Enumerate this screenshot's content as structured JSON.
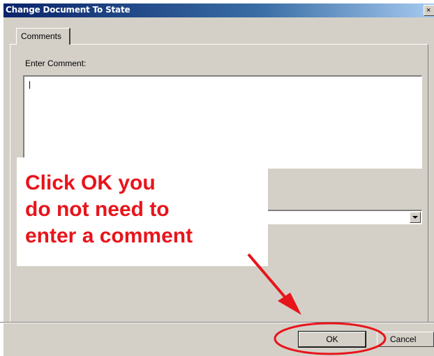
{
  "window": {
    "title": "Change Document To State",
    "close_glyph": "×"
  },
  "tabs": [
    {
      "label": "Comments",
      "active": true
    }
  ],
  "comment": {
    "label": "Enter Comment:",
    "value": "|"
  },
  "state_select": {
    "value": ""
  },
  "buttons": {
    "ok_label": "OK",
    "cancel_label": "Cancel"
  },
  "annotation": {
    "lines": [
      "Click OK you",
      "do not need to",
      "enter a comment"
    ],
    "color": "#e8141b"
  },
  "colors": {
    "dialog_bg": "#d4d0c8",
    "titlebar_start": "#0a246a",
    "titlebar_end": "#a6caf0",
    "annotation_red": "#e8141b"
  }
}
